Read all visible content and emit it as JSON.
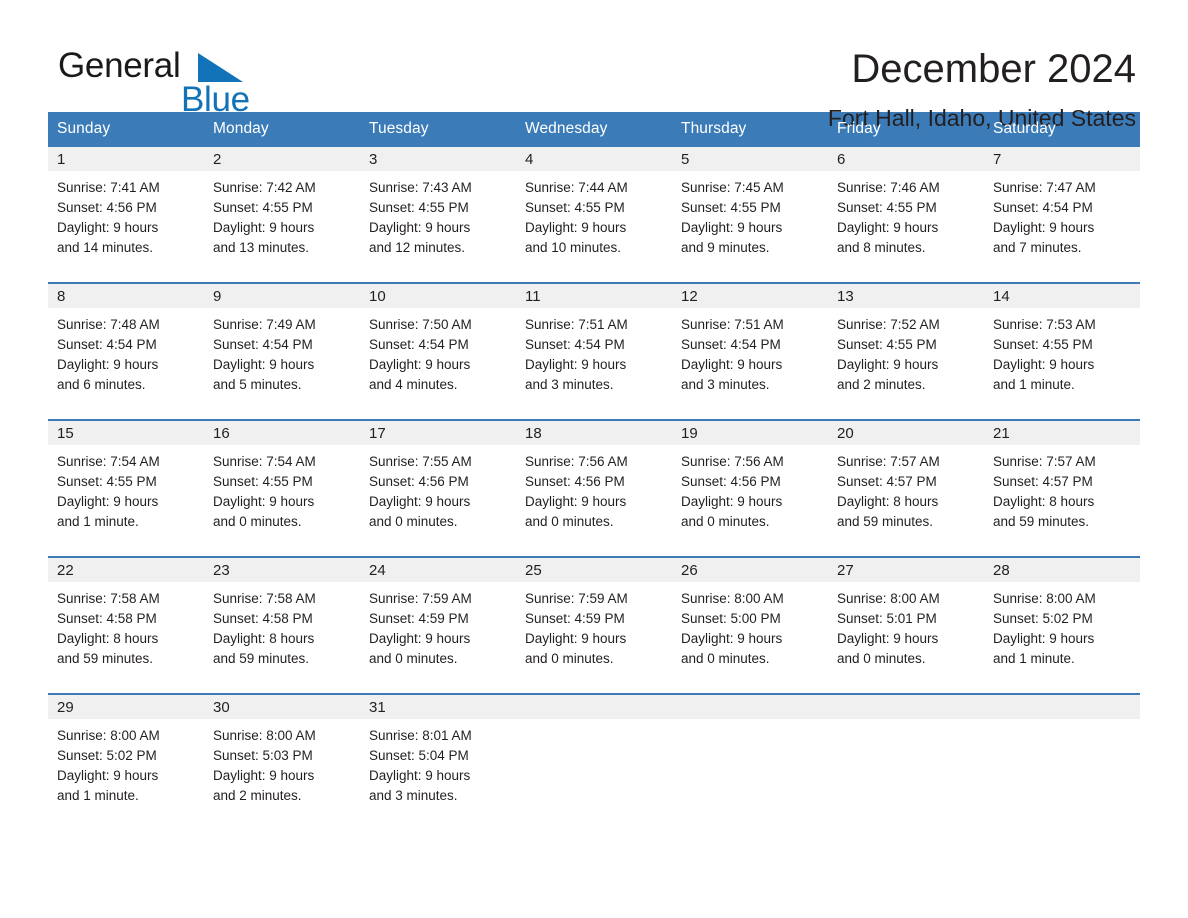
{
  "logo": {
    "word_dark": "General",
    "word_blue": "Blue",
    "flag_icon": "triangle-flag-icon",
    "brand_color": "#1273b8"
  },
  "header": {
    "title": "December 2024",
    "subtitle": "Fort Hall, Idaho, United States"
  },
  "theme": {
    "header_blue": "#3b7cb8",
    "row_divider_blue": "#3b7cb8",
    "daynum_band_gray": "#f0f0f0",
    "text_color": "#231f20"
  },
  "weekday_headers": [
    "Sunday",
    "Monday",
    "Tuesday",
    "Wednesday",
    "Thursday",
    "Friday",
    "Saturday"
  ],
  "labels": {
    "sunrise_prefix": "Sunrise:",
    "sunset_prefix": "Sunset:",
    "daylight_prefix": "Daylight:"
  },
  "weeks": [
    [
      {
        "day": "1",
        "sunrise": "Sunrise: 7:41 AM",
        "sunset": "Sunset: 4:56 PM",
        "daylight_line1": "Daylight: 9 hours",
        "daylight_line2": "and 14 minutes."
      },
      {
        "day": "2",
        "sunrise": "Sunrise: 7:42 AM",
        "sunset": "Sunset: 4:55 PM",
        "daylight_line1": "Daylight: 9 hours",
        "daylight_line2": "and 13 minutes."
      },
      {
        "day": "3",
        "sunrise": "Sunrise: 7:43 AM",
        "sunset": "Sunset: 4:55 PM",
        "daylight_line1": "Daylight: 9 hours",
        "daylight_line2": "and 12 minutes."
      },
      {
        "day": "4",
        "sunrise": "Sunrise: 7:44 AM",
        "sunset": "Sunset: 4:55 PM",
        "daylight_line1": "Daylight: 9 hours",
        "daylight_line2": "and 10 minutes."
      },
      {
        "day": "5",
        "sunrise": "Sunrise: 7:45 AM",
        "sunset": "Sunset: 4:55 PM",
        "daylight_line1": "Daylight: 9 hours",
        "daylight_line2": "and 9 minutes."
      },
      {
        "day": "6",
        "sunrise": "Sunrise: 7:46 AM",
        "sunset": "Sunset: 4:55 PM",
        "daylight_line1": "Daylight: 9 hours",
        "daylight_line2": "and 8 minutes."
      },
      {
        "day": "7",
        "sunrise": "Sunrise: 7:47 AM",
        "sunset": "Sunset: 4:54 PM",
        "daylight_line1": "Daylight: 9 hours",
        "daylight_line2": "and 7 minutes."
      }
    ],
    [
      {
        "day": "8",
        "sunrise": "Sunrise: 7:48 AM",
        "sunset": "Sunset: 4:54 PM",
        "daylight_line1": "Daylight: 9 hours",
        "daylight_line2": "and 6 minutes."
      },
      {
        "day": "9",
        "sunrise": "Sunrise: 7:49 AM",
        "sunset": "Sunset: 4:54 PM",
        "daylight_line1": "Daylight: 9 hours",
        "daylight_line2": "and 5 minutes."
      },
      {
        "day": "10",
        "sunrise": "Sunrise: 7:50 AM",
        "sunset": "Sunset: 4:54 PM",
        "daylight_line1": "Daylight: 9 hours",
        "daylight_line2": "and 4 minutes."
      },
      {
        "day": "11",
        "sunrise": "Sunrise: 7:51 AM",
        "sunset": "Sunset: 4:54 PM",
        "daylight_line1": "Daylight: 9 hours",
        "daylight_line2": "and 3 minutes."
      },
      {
        "day": "12",
        "sunrise": "Sunrise: 7:51 AM",
        "sunset": "Sunset: 4:54 PM",
        "daylight_line1": "Daylight: 9 hours",
        "daylight_line2": "and 3 minutes."
      },
      {
        "day": "13",
        "sunrise": "Sunrise: 7:52 AM",
        "sunset": "Sunset: 4:55 PM",
        "daylight_line1": "Daylight: 9 hours",
        "daylight_line2": "and 2 minutes."
      },
      {
        "day": "14",
        "sunrise": "Sunrise: 7:53 AM",
        "sunset": "Sunset: 4:55 PM",
        "daylight_line1": "Daylight: 9 hours",
        "daylight_line2": "and 1 minute."
      }
    ],
    [
      {
        "day": "15",
        "sunrise": "Sunrise: 7:54 AM",
        "sunset": "Sunset: 4:55 PM",
        "daylight_line1": "Daylight: 9 hours",
        "daylight_line2": "and 1 minute."
      },
      {
        "day": "16",
        "sunrise": "Sunrise: 7:54 AM",
        "sunset": "Sunset: 4:55 PM",
        "daylight_line1": "Daylight: 9 hours",
        "daylight_line2": "and 0 minutes."
      },
      {
        "day": "17",
        "sunrise": "Sunrise: 7:55 AM",
        "sunset": "Sunset: 4:56 PM",
        "daylight_line1": "Daylight: 9 hours",
        "daylight_line2": "and 0 minutes."
      },
      {
        "day": "18",
        "sunrise": "Sunrise: 7:56 AM",
        "sunset": "Sunset: 4:56 PM",
        "daylight_line1": "Daylight: 9 hours",
        "daylight_line2": "and 0 minutes."
      },
      {
        "day": "19",
        "sunrise": "Sunrise: 7:56 AM",
        "sunset": "Sunset: 4:56 PM",
        "daylight_line1": "Daylight: 9 hours",
        "daylight_line2": "and 0 minutes."
      },
      {
        "day": "20",
        "sunrise": "Sunrise: 7:57 AM",
        "sunset": "Sunset: 4:57 PM",
        "daylight_line1": "Daylight: 8 hours",
        "daylight_line2": "and 59 minutes."
      },
      {
        "day": "21",
        "sunrise": "Sunrise: 7:57 AM",
        "sunset": "Sunset: 4:57 PM",
        "daylight_line1": "Daylight: 8 hours",
        "daylight_line2": "and 59 minutes."
      }
    ],
    [
      {
        "day": "22",
        "sunrise": "Sunrise: 7:58 AM",
        "sunset": "Sunset: 4:58 PM",
        "daylight_line1": "Daylight: 8 hours",
        "daylight_line2": "and 59 minutes."
      },
      {
        "day": "23",
        "sunrise": "Sunrise: 7:58 AM",
        "sunset": "Sunset: 4:58 PM",
        "daylight_line1": "Daylight: 8 hours",
        "daylight_line2": "and 59 minutes."
      },
      {
        "day": "24",
        "sunrise": "Sunrise: 7:59 AM",
        "sunset": "Sunset: 4:59 PM",
        "daylight_line1": "Daylight: 9 hours",
        "daylight_line2": "and 0 minutes."
      },
      {
        "day": "25",
        "sunrise": "Sunrise: 7:59 AM",
        "sunset": "Sunset: 4:59 PM",
        "daylight_line1": "Daylight: 9 hours",
        "daylight_line2": "and 0 minutes."
      },
      {
        "day": "26",
        "sunrise": "Sunrise: 8:00 AM",
        "sunset": "Sunset: 5:00 PM",
        "daylight_line1": "Daylight: 9 hours",
        "daylight_line2": "and 0 minutes."
      },
      {
        "day": "27",
        "sunrise": "Sunrise: 8:00 AM",
        "sunset": "Sunset: 5:01 PM",
        "daylight_line1": "Daylight: 9 hours",
        "daylight_line2": "and 0 minutes."
      },
      {
        "day": "28",
        "sunrise": "Sunrise: 8:00 AM",
        "sunset": "Sunset: 5:02 PM",
        "daylight_line1": "Daylight: 9 hours",
        "daylight_line2": "and 1 minute."
      }
    ],
    [
      {
        "day": "29",
        "sunrise": "Sunrise: 8:00 AM",
        "sunset": "Sunset: 5:02 PM",
        "daylight_line1": "Daylight: 9 hours",
        "daylight_line2": "and 1 minute."
      },
      {
        "day": "30",
        "sunrise": "Sunrise: 8:00 AM",
        "sunset": "Sunset: 5:03 PM",
        "daylight_line1": "Daylight: 9 hours",
        "daylight_line2": "and 2 minutes."
      },
      {
        "day": "31",
        "sunrise": "Sunrise: 8:01 AM",
        "sunset": "Sunset: 5:04 PM",
        "daylight_line1": "Daylight: 9 hours",
        "daylight_line2": "and 3 minutes."
      },
      {
        "day": "",
        "sunrise": "",
        "sunset": "",
        "daylight_line1": "",
        "daylight_line2": ""
      },
      {
        "day": "",
        "sunrise": "",
        "sunset": "",
        "daylight_line1": "",
        "daylight_line2": ""
      },
      {
        "day": "",
        "sunrise": "",
        "sunset": "",
        "daylight_line1": "",
        "daylight_line2": ""
      },
      {
        "day": "",
        "sunrise": "",
        "sunset": "",
        "daylight_line1": "",
        "daylight_line2": ""
      }
    ]
  ]
}
